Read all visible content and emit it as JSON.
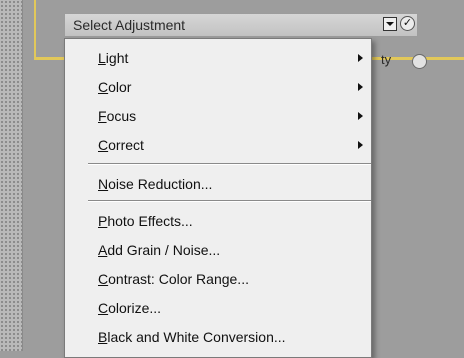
{
  "select": {
    "label": "Select Adjustment"
  },
  "side_label": "ty",
  "menu": {
    "submenus": [
      {
        "label": "Light"
      },
      {
        "label": "Color"
      },
      {
        "label": "Focus"
      },
      {
        "label": "Correct"
      }
    ],
    "noise_reduction": "Noise Reduction...",
    "effects": [
      {
        "label": "Photo Effects..."
      },
      {
        "label": "Add Grain / Noise..."
      },
      {
        "label": "Contrast: Color Range..."
      },
      {
        "label": "Colorize..."
      },
      {
        "label": "Black and White Conversion..."
      }
    ]
  }
}
